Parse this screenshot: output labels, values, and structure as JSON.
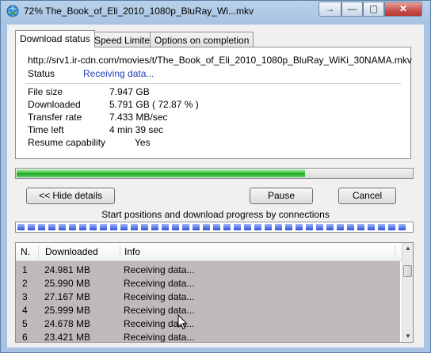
{
  "window": {
    "title": "72% The_Book_of_Eli_2010_1080p_BluRay_Wi...mkv",
    "app_icon": "globe-download-icon",
    "controls": {
      "extra": "→",
      "minimize": "—",
      "maximize": "▢",
      "close": "✕"
    }
  },
  "tabs": [
    {
      "label": "Download status"
    },
    {
      "label": "Speed Limiter"
    },
    {
      "label": "Options on completion"
    }
  ],
  "status": {
    "url": "http://srv1.ir-cdn.com/movies/t/The_Book_of_Eli_2010_1080p_BluRay_WiKi_30NAMA.mkv",
    "status_label": "Status",
    "status_value": "Receiving data...",
    "file_size_label": "File size",
    "file_size_value": "7.947  GB",
    "downloaded_label": "Downloaded",
    "downloaded_value": "5.791  GB  ( 72.87 % )",
    "transfer_rate_label": "Transfer rate",
    "transfer_rate_value": "7.433  MB/sec",
    "time_left_label": "Time left",
    "time_left_value": "4 min 39 sec",
    "resume_label": "Resume capability",
    "resume_value": "Yes"
  },
  "progress": {
    "percent": 72.87,
    "color": "#2fbf3a"
  },
  "buttons": {
    "hide_details": "<< Hide details",
    "pause": "Pause",
    "cancel": "Cancel"
  },
  "connections": {
    "caption": "Start positions and download progress by connections",
    "color": "#2d4fd6"
  },
  "connections_table": {
    "columns": [
      "N.",
      "Downloaded",
      "Info"
    ],
    "rows": [
      {
        "n": "1",
        "downloaded": "24.981  MB",
        "info": "Receiving data..."
      },
      {
        "n": "2",
        "downloaded": "25.990  MB",
        "info": "Receiving data..."
      },
      {
        "n": "3",
        "downloaded": "27.167  MB",
        "info": "Receiving data..."
      },
      {
        "n": "4",
        "downloaded": "25.999  MB",
        "info": "Receiving data..."
      },
      {
        "n": "5",
        "downloaded": "24.678  MB",
        "info": "Receiving data..."
      },
      {
        "n": "6",
        "downloaded": "23.421  MB",
        "info": "Receiving data..."
      }
    ]
  }
}
